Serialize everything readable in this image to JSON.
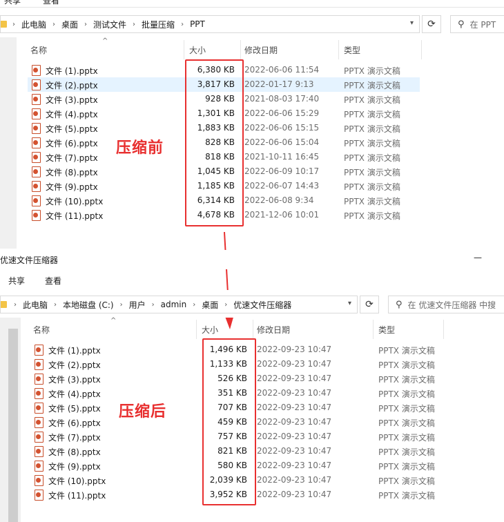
{
  "top": {
    "ribbon_tabs": [
      "共享",
      "查看"
    ],
    "breadcrumb": [
      "此电脑",
      "桌面",
      "测试文件",
      "批量压缩",
      "PPT"
    ],
    "search_placeholder": "在 PPT",
    "columns": [
      "名称",
      "大小",
      "修改日期",
      "类型"
    ],
    "files": [
      {
        "name": "文件 (1).pptx",
        "size": "6,380 KB",
        "date": "2022-06-06 11:54",
        "type": "PPTX 演示文稿"
      },
      {
        "name": "文件 (2).pptx",
        "size": "3,817 KB",
        "date": "2022-01-17 9:13",
        "type": "PPTX 演示文稿",
        "selected": true
      },
      {
        "name": "文件 (3).pptx",
        "size": "928 KB",
        "date": "2021-08-03 17:40",
        "type": "PPTX 演示文稿"
      },
      {
        "name": "文件 (4).pptx",
        "size": "1,301 KB",
        "date": "2022-06-06 15:29",
        "type": "PPTX 演示文稿"
      },
      {
        "name": "文件 (5).pptx",
        "size": "1,883 KB",
        "date": "2022-06-06 15:15",
        "type": "PPTX 演示文稿"
      },
      {
        "name": "文件 (6).pptx",
        "size": "828 KB",
        "date": "2022-06-06 15:04",
        "type": "PPTX 演示文稿"
      },
      {
        "name": "文件 (7).pptx",
        "size": "818 KB",
        "date": "2021-10-11 16:45",
        "type": "PPTX 演示文稿"
      },
      {
        "name": "文件 (8).pptx",
        "size": "1,045 KB",
        "date": "2022-06-09 10:17",
        "type": "PPTX 演示文稿"
      },
      {
        "name": "文件 (9).pptx",
        "size": "1,185 KB",
        "date": "2022-06-07 14:43",
        "type": "PPTX 演示文稿"
      },
      {
        "name": "文件 (10).pptx",
        "size": "6,314 KB",
        "date": "2022-06-08 9:34",
        "type": "PPTX 演示文稿"
      },
      {
        "name": "文件 (11).pptx",
        "size": "4,678 KB",
        "date": "2021-12-06 10:01",
        "type": "PPTX 演示文稿"
      }
    ],
    "annotation": "压缩前"
  },
  "bottom": {
    "window_title": "优速文件压缩器",
    "minimize_glyph": "—",
    "ribbon_tabs": [
      "共享",
      "查看"
    ],
    "breadcrumb": [
      "此电脑",
      "本地磁盘 (C:)",
      "用户",
      "admin",
      "桌面",
      "优速文件压缩器"
    ],
    "search_placeholder": "在 优速文件压缩器 中搜",
    "columns": [
      "名称",
      "大小",
      "修改日期",
      "类型"
    ],
    "files": [
      {
        "name": "文件 (1).pptx",
        "size": "1,496 KB",
        "date": "2022-09-23 10:47",
        "type": "PPTX 演示文稿"
      },
      {
        "name": "文件 (2).pptx",
        "size": "1,133 KB",
        "date": "2022-09-23 10:47",
        "type": "PPTX 演示文稿"
      },
      {
        "name": "文件 (3).pptx",
        "size": "526 KB",
        "date": "2022-09-23 10:47",
        "type": "PPTX 演示文稿"
      },
      {
        "name": "文件 (4).pptx",
        "size": "351 KB",
        "date": "2022-09-23 10:47",
        "type": "PPTX 演示文稿"
      },
      {
        "name": "文件 (5).pptx",
        "size": "707 KB",
        "date": "2022-09-23 10:47",
        "type": "PPTX 演示文稿"
      },
      {
        "name": "文件 (6).pptx",
        "size": "459 KB",
        "date": "2022-09-23 10:47",
        "type": "PPTX 演示文稿"
      },
      {
        "name": "文件 (7).pptx",
        "size": "757 KB",
        "date": "2022-09-23 10:47",
        "type": "PPTX 演示文稿"
      },
      {
        "name": "文件 (8).pptx",
        "size": "821 KB",
        "date": "2022-09-23 10:47",
        "type": "PPTX 演示文稿"
      },
      {
        "name": "文件 (9).pptx",
        "size": "580 KB",
        "date": "2022-09-23 10:47",
        "type": "PPTX 演示文稿"
      },
      {
        "name": "文件 (10).pptx",
        "size": "2,039 KB",
        "date": "2022-09-23 10:47",
        "type": "PPTX 演示文稿"
      },
      {
        "name": "文件 (11).pptx",
        "size": "3,952 KB",
        "date": "2022-09-23 10:47",
        "type": "PPTX 演示文稿"
      }
    ],
    "annotation": "压缩后"
  },
  "icons": {
    "file": "pptx-file-icon",
    "refresh": "refresh-icon",
    "search": "search-icon",
    "folder": "folder-icon",
    "chevron": "chevron-right-icon",
    "dropdown": "chevron-down-icon",
    "sort": "sort-caret-icon"
  },
  "colors": {
    "annotation_red": "#e82f2f",
    "selection": "#e5f3ff"
  }
}
